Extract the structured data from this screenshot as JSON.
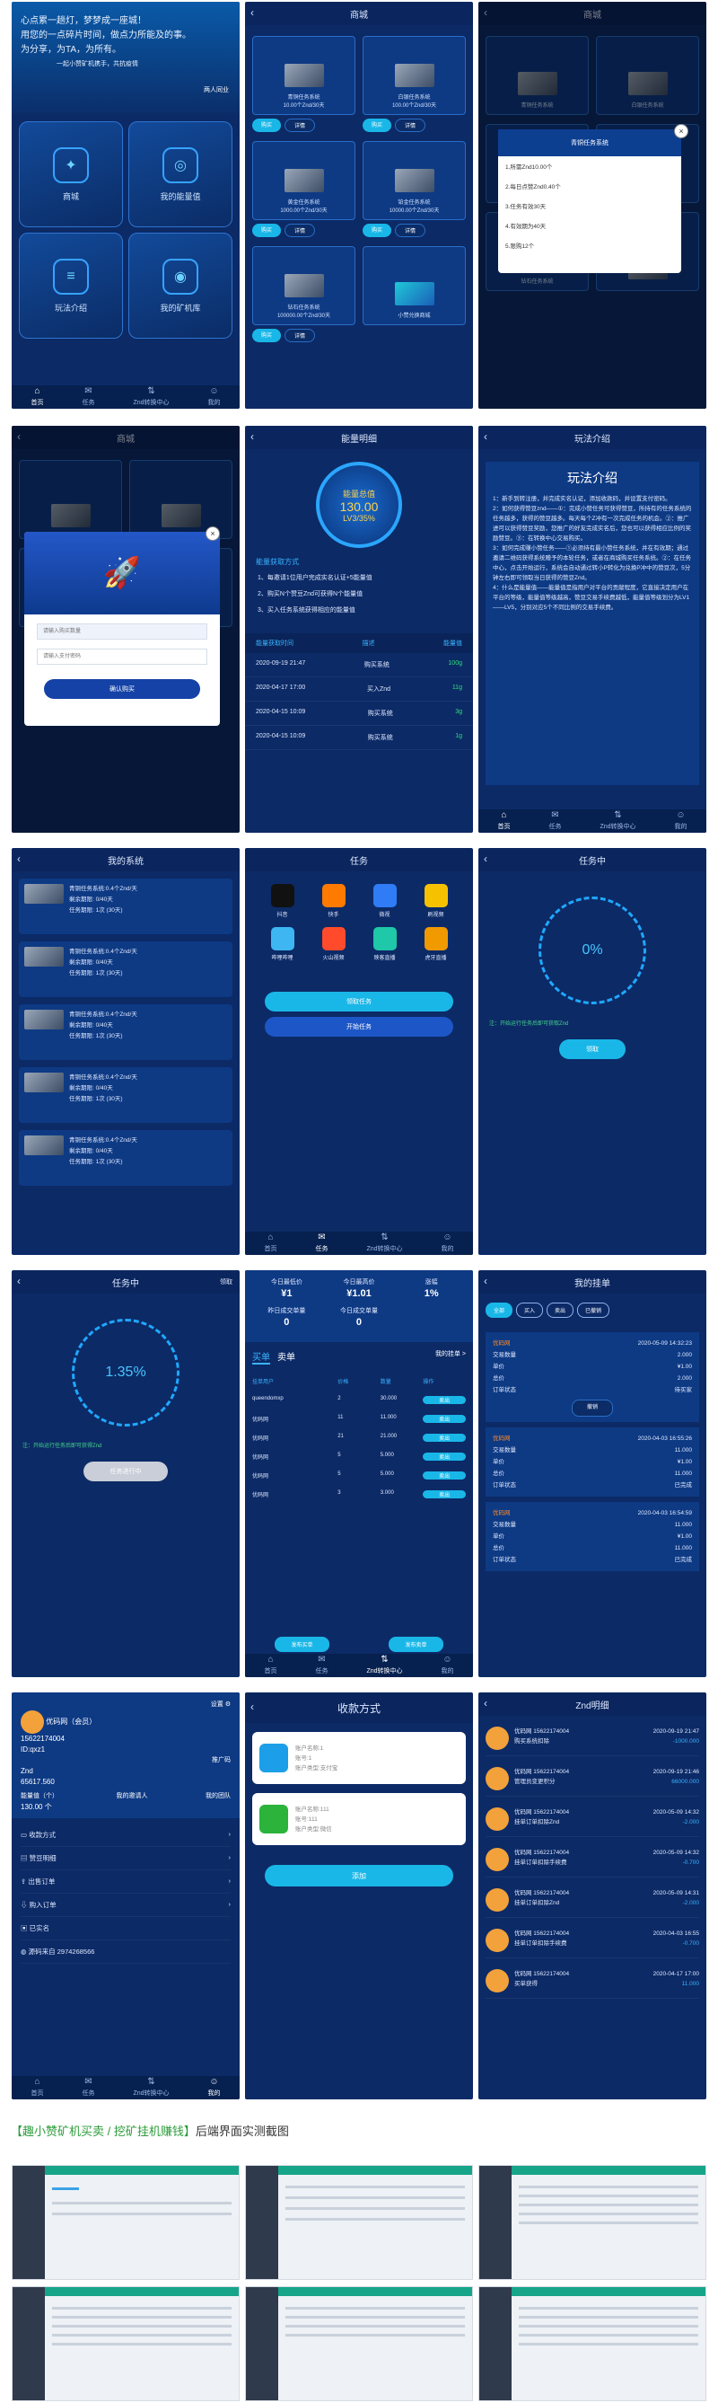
{
  "tabbar": {
    "home": "首页",
    "task": "任务",
    "znd": "Znd转换中心",
    "mine": "我的"
  },
  "p1": {
    "lines": [
      "心点累一趟灯，梦梦成一座城！",
      "用您的一点碎片时间，做点力所能及的事。",
      "为分享，为TA，为所有。",
      "一起小赞矿机携手，共抗疫情"
    ],
    "sig": "两人同业",
    "tiles": [
      "商城",
      "我的能量值",
      "玩法介绍",
      "我的矿机库"
    ]
  },
  "shop": {
    "title": "商城",
    "items": [
      {
        "name": "青铜任务系统",
        "sub": "10.00个Znd/30天"
      },
      {
        "name": "白银任务系统",
        "sub": "100.00个Znd/30天"
      },
      {
        "name": "黄金任务系统",
        "sub": "1000.00个Znd/30天"
      },
      {
        "name": "铂金任务系统",
        "sub": "10000.00个Znd/30天"
      },
      {
        "name": "钻石任务系统",
        "sub": "100000.00个Znd/30天"
      },
      {
        "name": "小赞兑换商城",
        "sub": ""
      }
    ],
    "buy": "购买",
    "detail": "详情"
  },
  "p3": {
    "modal_title": "青铜任务系统",
    "items": [
      "1.所需Znd10.00个",
      "2.每日点赞Znd0.40个",
      "3.任务有效30天",
      "4.有效期为40天",
      "5.限购12个"
    ]
  },
  "p4": {
    "title": "商城",
    "input1": "请输入购买数量",
    "input2": "请输入支付密码",
    "confirm": "确认购买"
  },
  "energy": {
    "title": "能量明细",
    "g1": "能量总值",
    "g2": "130.00",
    "g3": "LV3/35%",
    "sec": "能量获取方式",
    "ways": [
      "1、每邀请1位用户完成实名认证+5能量值",
      "2、购买N个赞豆Znd可获得N个能量值",
      "3、买入任务系统获得相应的能量值"
    ],
    "hdr": [
      "能量获取时间",
      "描述",
      "能量值"
    ],
    "rows": [
      {
        "t": "2020-09-19 21:47",
        "d": "购买系统",
        "v": "100g"
      },
      {
        "t": "2020-04-17 17:00",
        "d": "买入Znd",
        "v": "11g"
      },
      {
        "t": "2020-04-15 10:09",
        "d": "购买系统",
        "v": "3g"
      },
      {
        "t": "2020-04-15 10:09",
        "d": "购买系统",
        "v": "1g"
      }
    ]
  },
  "rules": {
    "title": "玩法介绍",
    "head": "玩法介绍",
    "paras": [
      "1：新手到转注册，并完成实名认证，添加收款码，并设置支付密码。",
      "2：如何获得赞豆znd——①：完成小赞任务可获得赞豆，所持有的任务系统的任务越多，获得的赞豆越多。每天每个Z冲有一次完成任务的机会。②：推广进可以获得赞豆奖励，您推广的好友完成实名后，您也可以获得相应比例的奖励赞豆。③：在转换中心交易购买。",
      "3：如何完成赚小赞任务——①必须持有最小赞任务系统，并在有效期；通过邀请二维码获得系统赠予的本轮任务，或者在商城购买任务系统。②：在任务中心，点击开始运行，系统会自动通过转小P转化为兑换P冲中的赞豆次，5分钟左右即可领取当日获得的赞豆Znd。",
      "4：什么是能量值——能量值是指用户对平台的贡献程度，它直接决定用户在平台的等级，能量值等级越高，赞豆交易手续费越低，能量值等级划分为LV1——LV5，分别对应5个不同比例的交易手续费。"
    ]
  },
  "mysys": {
    "title": "我的系统",
    "items": [
      {
        "name": "青铜任务系统:0.4个Znd/天",
        "l1": "剩余期限: 0/40天",
        "l2": "任务期限: 1次 (30天)"
      },
      {
        "name": "青铜任务系统:0.4个Znd/天",
        "l1": "剩余期限: 0/40天",
        "l2": "任务期限: 1次 (30天)"
      },
      {
        "name": "青铜任务系统:0.4个Znd/天",
        "l1": "剩余期限: 0/40天",
        "l2": "任务期限: 1次 (30天)"
      },
      {
        "name": "青铜任务系统:0.4个Znd/天",
        "l1": "剩余期限: 0/40天",
        "l2": "任务期限: 1次 (30天)"
      },
      {
        "name": "青铜任务系统:0.4个Znd/天",
        "l1": "剩余期限: 0/40天",
        "l2": "任务期限: 1次 (30天)"
      }
    ]
  },
  "task": {
    "title": "任务",
    "apps": [
      {
        "n": "抖音",
        "c": "#111"
      },
      {
        "n": "快手",
        "c": "#ff7a00"
      },
      {
        "n": "微视",
        "c": "#2f7cf6"
      },
      {
        "n": "刷视频",
        "c": "#f6c200"
      },
      {
        "n": "哔哩哔哩",
        "c": "#3db6f2"
      },
      {
        "n": "火山视频",
        "c": "#ff4b2b"
      },
      {
        "n": "映客直播",
        "c": "#1ec8a8"
      },
      {
        "n": "虎牙直播",
        "c": "#f09a00"
      }
    ],
    "b1": "领取任务",
    "b2": "开始任务"
  },
  "running": {
    "title": "任务中",
    "pct": "0%",
    "note": "注：开始运行任务后即可获取Znd",
    "btn": "领取"
  },
  "running2": {
    "title": "任务中",
    "right": "领取",
    "pct": "1.35%",
    "note": "注：开始运行任务后即可获得Znd",
    "btn": "任务进行中"
  },
  "trade": {
    "stats": [
      {
        "k": "今日最低价",
        "v": "¥1"
      },
      {
        "k": "今日最高价",
        "v": "¥1.01"
      },
      {
        "k": "涨幅",
        "v": "1%"
      },
      {
        "k": "昨日成交单量",
        "v": "0"
      },
      {
        "k": "今日成交单量",
        "v": "0"
      }
    ],
    "t1": "买单",
    "t2": "卖单",
    "link": "我的挂单 >",
    "hdr": [
      "挂单用户",
      "价格",
      "数量",
      "操作"
    ],
    "rows": [
      {
        "u": "queendomxp",
        "p": "2",
        "q": "30.000"
      },
      {
        "u": "优码网",
        "p": "11",
        "q": "11.000"
      },
      {
        "u": "优码网",
        "p": "21",
        "q": "21.000"
      },
      {
        "u": "优码网",
        "p": "5",
        "q": "5.000"
      },
      {
        "u": "优码网",
        "p": "5",
        "q": "5.000"
      },
      {
        "u": "优码网",
        "p": "3",
        "q": "3.000"
      }
    ],
    "sell": "卖出",
    "f1": "发布买单",
    "f2": "发布卖单"
  },
  "orders": {
    "title": "我的挂单",
    "tabs": [
      "全部",
      "买入",
      "卖出",
      "已撤销"
    ],
    "list": [
      {
        "u": "优码网",
        "t": "2020-05-09 14:32:23",
        "a": "2.000",
        "p": "¥1.00",
        "s": "2.000",
        "st": "待买家",
        "btn": "撤销"
      },
      {
        "u": "优码网",
        "t": "2020-04-03 16:55:26",
        "a": "11.000",
        "p": "¥1.00",
        "s": "11.000",
        "st": "已完成",
        "btn": ""
      },
      {
        "u": "优码网",
        "t": "2020-04-03 16:54:59",
        "a": "11.000",
        "p": "¥1.00",
        "s": "11.000",
        "st": "已完成",
        "btn": ""
      }
    ],
    "labels": [
      "交易数量",
      "单价",
      "总价",
      "订单状态"
    ]
  },
  "profile": {
    "settings": "设置",
    "name": "优码网（会员）",
    "phone": "15622174004",
    "id": "ID:qxz1",
    "qr": "推广码",
    "znd": "Znd",
    "zndv": "65617.560",
    "energy": "能量值（个）",
    "ev": "130.00 个",
    "inviter": "我的邀请人",
    "team": "我的团队",
    "menu": [
      "收款方式",
      "赞豆明细",
      "出售订单",
      "购入订单",
      "已实名",
      "源码来自 2974268566"
    ]
  },
  "pay": {
    "title": "收款方式",
    "a1": [
      "账户名称:1",
      "账号:1",
      "账户类型:支付宝"
    ],
    "a2": [
      "账户名称:111",
      "账号:111",
      "账户类型:微信"
    ],
    "add": "添加"
  },
  "znd": {
    "title": "Znd明细",
    "rows": [
      {
        "u": "优码网 15622174004",
        "d": "购买系统扣除",
        "t": "2020-09-19 21:47",
        "v": "-1000.000"
      },
      {
        "u": "优码网 15622174004",
        "d": "管理员变更积分",
        "t": "2020-09-19 21:46",
        "v": "66000.000"
      },
      {
        "u": "优码网 15622174004",
        "d": "挂单订单扣除Znd",
        "t": "2020-05-09 14:32",
        "v": "-2.000"
      },
      {
        "u": "优码网 15622174004",
        "d": "挂单订单扣除手续费",
        "t": "2020-05-09 14:32",
        "v": "-0.700"
      },
      {
        "u": "优码网 15622174004",
        "d": "挂单订单扣除Znd",
        "t": "2020-05-09 14:31",
        "v": "-2.000"
      },
      {
        "u": "优码网 15622174004",
        "d": "挂单订单扣除手续费",
        "t": "2020-04-03 16:55",
        "v": "-0.700"
      },
      {
        "u": "优码网 15622174004",
        "d": "买单获得",
        "t": "2020-04-17 17:00",
        "v": "11.000"
      }
    ]
  },
  "caption": {
    "a": "【趣小赞矿机买卖 / 挖矿挂机赚钱】",
    "b": "后端界面实测截图"
  }
}
